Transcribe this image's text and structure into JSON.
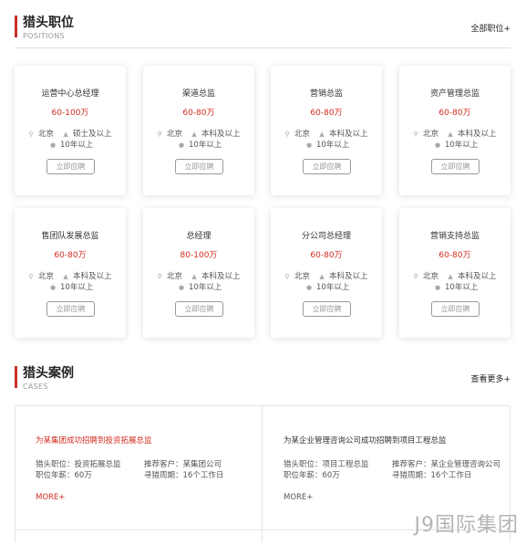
{
  "positions_section": {
    "title": "猎头职位",
    "subtitle": "POSITIONS",
    "more": "全部职位+"
  },
  "jobs": [
    {
      "name": "运营中心总经理",
      "salary": "60-100万",
      "city": "北京",
      "education": "硕士及以上",
      "experience": "10年以上",
      "apply": "立即应聘"
    },
    {
      "name": "渠道总监",
      "salary": "60-80万",
      "city": "北京",
      "education": "本科及以上",
      "experience": "10年以上",
      "apply": "立即应聘"
    },
    {
      "name": "营销总监",
      "salary": "60-80万",
      "city": "北京",
      "education": "本科及以上",
      "experience": "10年以上",
      "apply": "立即应聘"
    },
    {
      "name": "资产管理总监",
      "salary": "60-80万",
      "city": "北京",
      "education": "本科及以上",
      "experience": "10年以上",
      "apply": "立即应聘"
    },
    {
      "name": "售团队发展总监",
      "salary": "60-80万",
      "city": "北京",
      "education": "本科及以上",
      "experience": "10年以上",
      "apply": "立即应聘"
    },
    {
      "name": "总经理",
      "salary": "80-100万",
      "city": "北京",
      "education": "本科及以上",
      "experience": "10年以上",
      "apply": "立即应聘"
    },
    {
      "name": "分公司总经理",
      "salary": "60-80万",
      "city": "北京",
      "education": "本科及以上",
      "experience": "10年以上",
      "apply": "立即应聘"
    },
    {
      "name": "营销支持总监",
      "salary": "60-80万",
      "city": "北京",
      "education": "本科及以上",
      "experience": "10年以上",
      "apply": "立即应聘"
    }
  ],
  "cases_section": {
    "title": "猎头案例",
    "subtitle": "CASES",
    "more": "查看更多+"
  },
  "cases": [
    {
      "title": "为某集团成功招聘到投资拓展总监",
      "position": "猎头职位：投资拓展总监",
      "salary": "职位年薪：60万",
      "client": "推荐客户：某集团公司",
      "period": "寻猎周期：16个工作日",
      "more": "MORE+"
    },
    {
      "title": "为某企业管理咨询公司成功招聘到项目工程总监",
      "position": "猎头职位：项目工程总监",
      "salary": "职位年薪：60万",
      "client": "推荐客户：某企业管理咨询公司",
      "period": "寻猎周期：16个工作日",
      "more": "MORE+"
    }
  ],
  "watermark": "J9国际集团",
  "colors": {
    "accent": "#c8312b",
    "salary": "#d12c1f"
  },
  "icons": {
    "city": "location-pin-icon",
    "education": "graduation-cap-icon",
    "experience": "clock-icon"
  }
}
